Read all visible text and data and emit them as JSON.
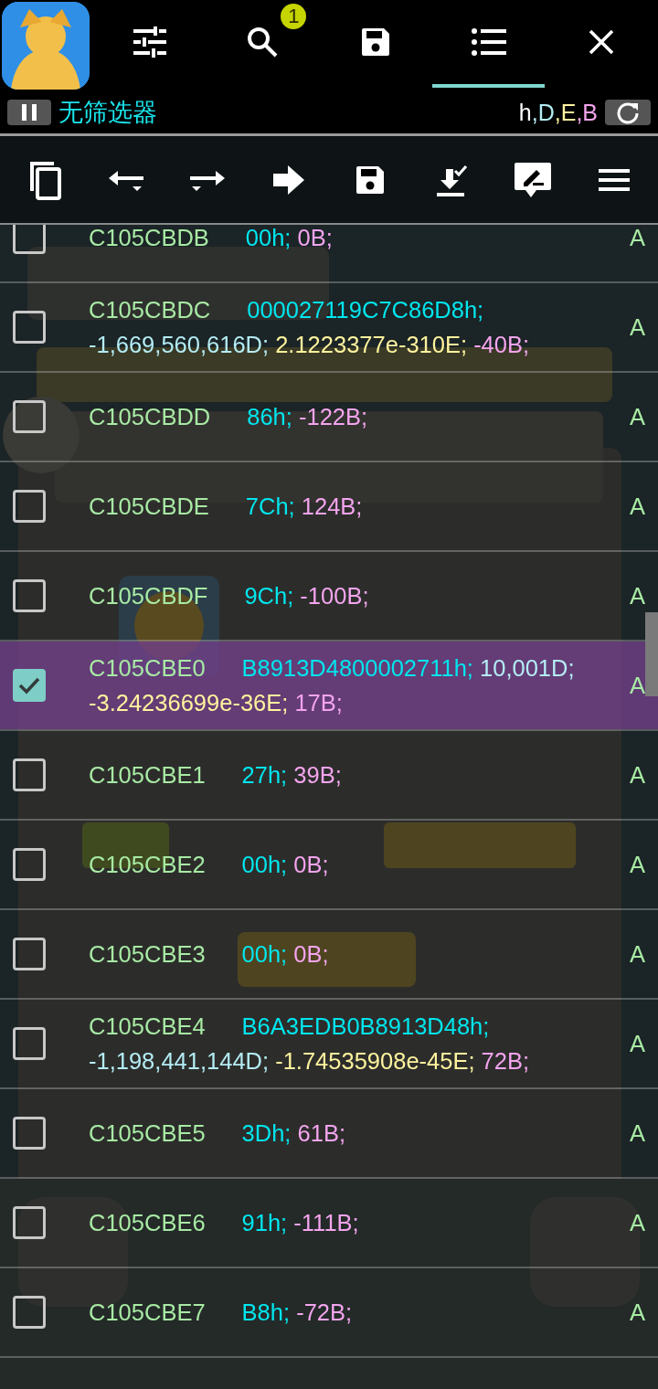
{
  "header": {
    "tabs": [
      {
        "kind": "sliders",
        "selected": false
      },
      {
        "kind": "search",
        "selected": false,
        "badge": "1"
      },
      {
        "kind": "save",
        "selected": false
      },
      {
        "kind": "list",
        "selected": true
      },
      {
        "kind": "close",
        "selected": false
      }
    ]
  },
  "filter_bar": {
    "label": "无筛选器",
    "types": [
      {
        "kind": "h",
        "text": "h"
      },
      {
        "kind": "D",
        "text": ",D"
      },
      {
        "kind": "E",
        "text": ",E"
      },
      {
        "kind": "B",
        "text": ",B"
      }
    ]
  },
  "toolbar": [
    {
      "kind": "copy"
    },
    {
      "kind": "back"
    },
    {
      "kind": "forward"
    },
    {
      "kind": "go"
    },
    {
      "kind": "save"
    },
    {
      "kind": "import"
    },
    {
      "kind": "edit"
    },
    {
      "kind": "menu"
    }
  ],
  "rows": [
    {
      "address": "C105CBDB",
      "values": [
        {
          "kind": "h",
          "text": "00h;"
        },
        {
          "kind": "B",
          "text": "0B;"
        }
      ],
      "flag": "A",
      "checked": false
    },
    {
      "address": "C105CBDC",
      "values": [
        {
          "kind": "h",
          "text": "000027119C7C86D8h;"
        },
        {
          "kind": "D",
          "text": "-1,669,560,616D;"
        },
        {
          "kind": "E",
          "text": "2.1223377e-310E;"
        },
        {
          "kind": "B",
          "text": "-40B;"
        }
      ],
      "flag": "A",
      "checked": false
    },
    {
      "address": "C105CBDD",
      "values": [
        {
          "kind": "h",
          "text": "86h;"
        },
        {
          "kind": "B",
          "text": "-122B;"
        }
      ],
      "flag": "A",
      "checked": false
    },
    {
      "address": "C105CBDE",
      "values": [
        {
          "kind": "h",
          "text": "7Ch;"
        },
        {
          "kind": "B",
          "text": "124B;"
        }
      ],
      "flag": "A",
      "checked": false
    },
    {
      "address": "C105CBDF",
      "values": [
        {
          "kind": "h",
          "text": "9Ch;"
        },
        {
          "kind": "B",
          "text": "-100B;"
        }
      ],
      "flag": "A",
      "checked": false
    },
    {
      "address": "C105CBE0",
      "values": [
        {
          "kind": "h",
          "text": "B8913D4800002711h;"
        },
        {
          "kind": "D",
          "text": "10,001D;"
        },
        {
          "kind": "E",
          "text": "-3.24236699e-36E;"
        },
        {
          "kind": "B",
          "text": "17B;"
        }
      ],
      "flag": "A",
      "checked": true
    },
    {
      "address": "C105CBE1",
      "values": [
        {
          "kind": "h",
          "text": "27h;"
        },
        {
          "kind": "B",
          "text": "39B;"
        }
      ],
      "flag": "A",
      "checked": false
    },
    {
      "address": "C105CBE2",
      "values": [
        {
          "kind": "h",
          "text": "00h;"
        },
        {
          "kind": "B",
          "text": "0B;"
        }
      ],
      "flag": "A",
      "checked": false
    },
    {
      "address": "C105CBE3",
      "values": [
        {
          "kind": "h",
          "text": "00h;"
        },
        {
          "kind": "B",
          "text": "0B;"
        }
      ],
      "flag": "A",
      "checked": false
    },
    {
      "address": "C105CBE4",
      "values": [
        {
          "kind": "h",
          "text": "B6A3EDB0B8913D48h;"
        },
        {
          "kind": "D",
          "text": "-1,198,441,144D;"
        },
        {
          "kind": "E",
          "text": "-1.74535908e-45E;"
        },
        {
          "kind": "B",
          "text": "72B;"
        }
      ],
      "flag": "A",
      "checked": false
    },
    {
      "address": "C105CBE5",
      "values": [
        {
          "kind": "h",
          "text": "3Dh;"
        },
        {
          "kind": "B",
          "text": "61B;"
        }
      ],
      "flag": "A",
      "checked": false
    },
    {
      "address": "C105CBE6",
      "values": [
        {
          "kind": "h",
          "text": "91h;"
        },
        {
          "kind": "B",
          "text": "-111B;"
        }
      ],
      "flag": "A",
      "checked": false
    },
    {
      "address": "C105CBE7",
      "values": [
        {
          "kind": "h",
          "text": "B8h;"
        },
        {
          "kind": "B",
          "text": "-72B;"
        }
      ],
      "flag": "A",
      "checked": false
    }
  ]
}
